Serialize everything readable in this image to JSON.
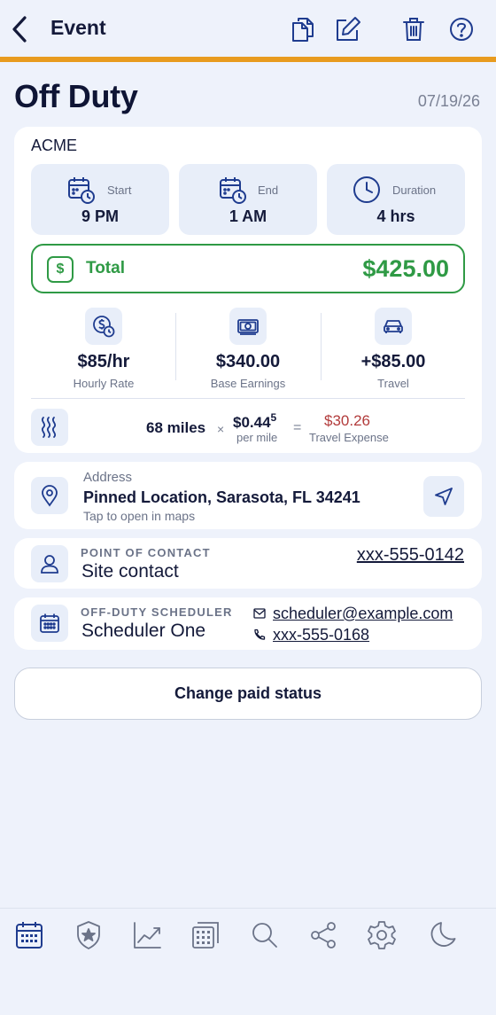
{
  "header": {
    "title": "Event",
    "accent_color": "#e89b1f",
    "actions": [
      "copy-icon",
      "edit-icon",
      "trash-icon",
      "help-icon"
    ]
  },
  "page": {
    "title": "Off Duty",
    "date": "07/19/26"
  },
  "event": {
    "company": "ACME",
    "start": {
      "label": "Start",
      "value": "9 PM"
    },
    "end": {
      "label": "End",
      "value": "1 AM"
    },
    "duration": {
      "label": "Duration",
      "value": "4 hrs"
    },
    "total": {
      "icon": "$",
      "label": "Total",
      "amount": "$425.00",
      "color": "#2f9a45"
    },
    "earnings": [
      {
        "value": "$85/hr",
        "label": "Hourly Rate",
        "icon": "dollar-clock-icon"
      },
      {
        "value": "$340.00",
        "label": "Base Earnings",
        "icon": "cash-icon"
      },
      {
        "value": "+$85.00",
        "label": "Travel",
        "icon": "car-icon"
      }
    ],
    "travel": {
      "miles": "68 miles",
      "times": "×",
      "rate": "$0.44",
      "rate_sup": "5",
      "rate_unit": "per mile",
      "equals": "=",
      "expense": "$30.26",
      "expense_label": "Travel Expense",
      "expense_color": "#b23b3b"
    }
  },
  "address": {
    "label": "Address",
    "value": "Pinned Location, Sarasota, FL 34241",
    "hint": "Tap to open in maps"
  },
  "contact": {
    "label": "POINT OF CONTACT",
    "name": "Site contact",
    "phone": "xxx-555-0142"
  },
  "scheduler": {
    "label": "OFF-DUTY SCHEDULER",
    "name": "Scheduler One",
    "email": "scheduler@example.com",
    "phone": "xxx-555-0168"
  },
  "actions": {
    "paid_status": "Change paid status"
  },
  "bottom_nav": [
    "calendar-icon",
    "badge-icon",
    "chart-icon",
    "grid-calendar-icon",
    "search-icon",
    "share-icon",
    "settings-icon",
    "moon-icon"
  ],
  "colors": {
    "primary": "#1f3c8f",
    "background": "#eef2fb"
  }
}
